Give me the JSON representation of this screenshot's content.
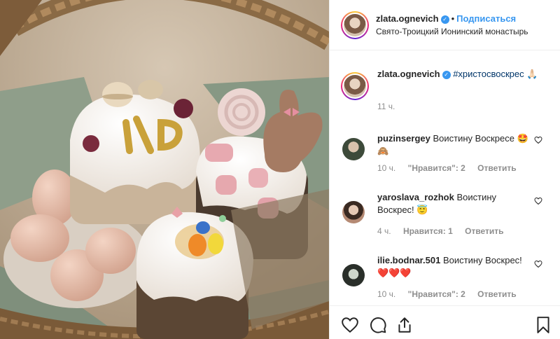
{
  "post": {
    "author": "zlata.ognevich",
    "follow_label": "Подписаться",
    "separator": "•",
    "location": "Свято-Троицкий Ионинский монастырь"
  },
  "caption": {
    "author": "zlata.ognevich",
    "hashtag": "#христосвоскрес",
    "emoji": "🙏🏻",
    "time": "11 ч."
  },
  "comments": [
    {
      "author": "puzinsergey",
      "text": "Воистину Воскресе 🤩🙈",
      "time": "10 ч.",
      "likes": "\"Нравится\": 2",
      "reply": "Ответить"
    },
    {
      "author": "yaroslava_rozhok",
      "text": "Воистину Воскрес! 😇",
      "time": "4 ч.",
      "likes": "Нравится: 1",
      "reply": "Ответить"
    },
    {
      "author": "ilie.bodnar.501",
      "text": "Воистину Воскрес! ❤️❤️❤️",
      "time": "10 ч.",
      "likes": "\"Нравится\": 2",
      "reply": "Ответить"
    }
  ],
  "icons": {
    "like": "heart-icon",
    "comment": "comment-icon",
    "share": "share-icon",
    "save": "bookmark-icon",
    "verified": "verified-badge-icon"
  },
  "colors": {
    "link_blue": "#3897f0",
    "hashtag": "#003569",
    "meta_gray": "#8e8e8e",
    "text": "#262626"
  }
}
